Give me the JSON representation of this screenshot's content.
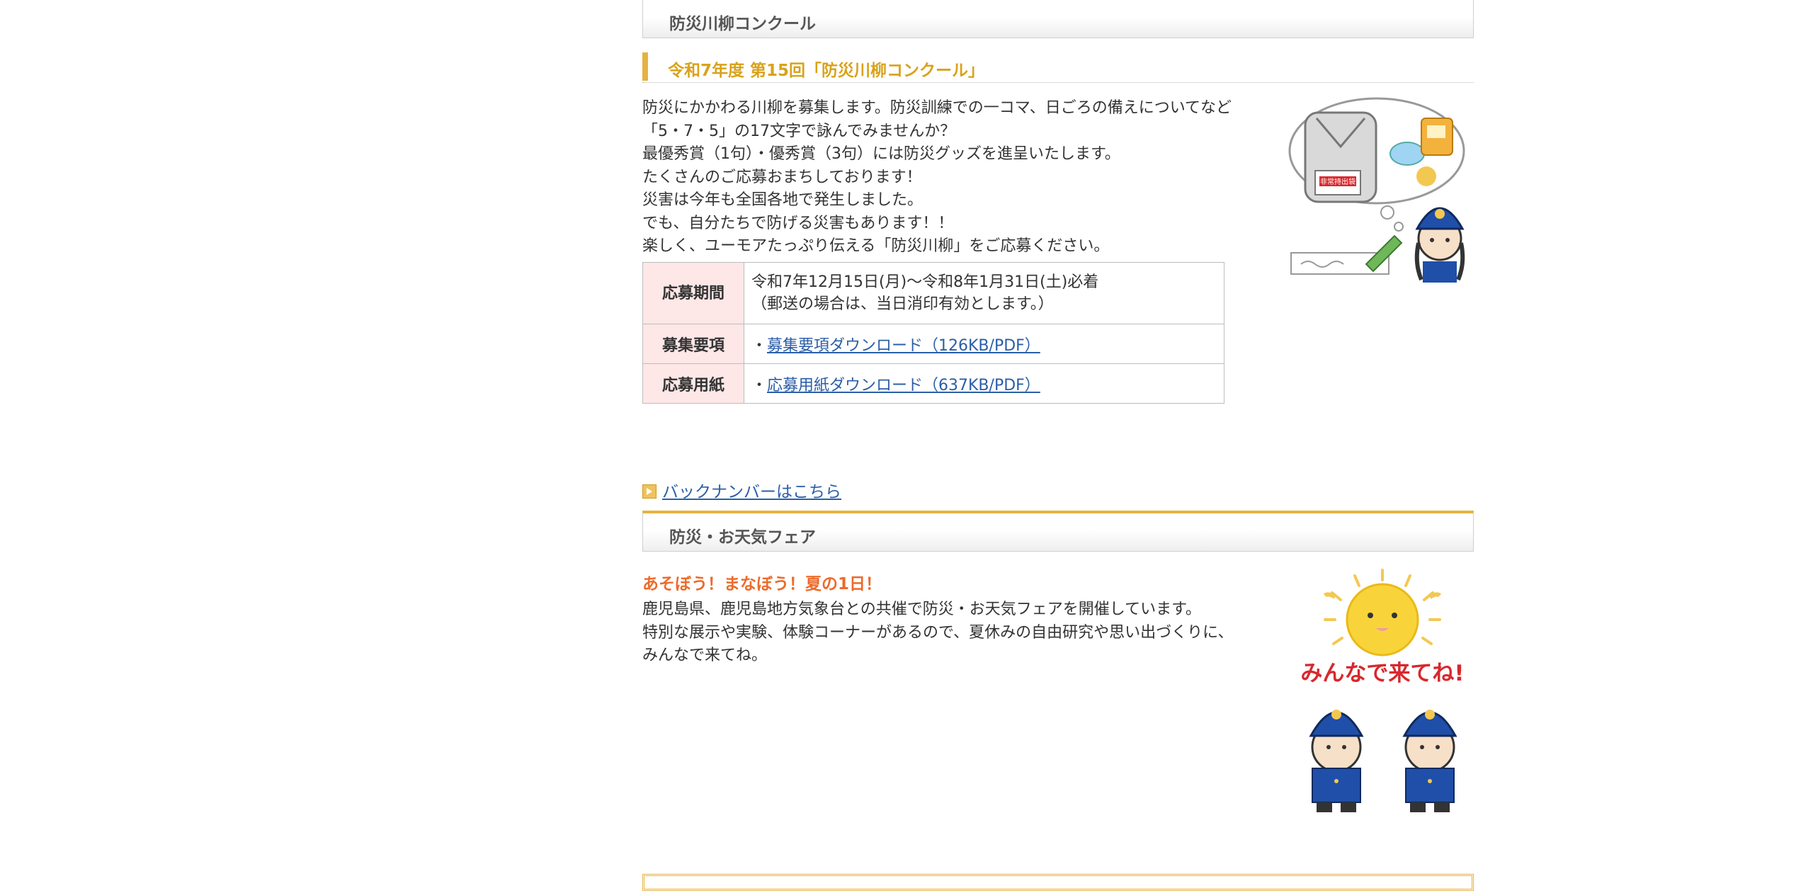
{
  "section1": {
    "header": "防災川柳コンクール",
    "subheader": "令和7年度 第15回「防災川柳コンクール」",
    "description": [
      "防災にかかわる川柳を募集します。防災訓練での一コマ、日ごろの備えについてなど",
      "「5・7・5」の17文字で詠んでみませんか？",
      "最優秀賞（1句）・優秀賞（3句）には防災グッズを進呈いたします。",
      "たくさんのご応募おまちしております！",
      "災害は今年も全国各地で発生しました。",
      "でも、自分たちで防げる災害もあります！！",
      "楽しく、ユーモアたっぷり伝える「防災川柳」をご応募ください。"
    ],
    "table": {
      "period_label": "応募期間",
      "period_line1": "令和7年12月15日(月)～令和8年1月31日(土)必着",
      "period_line2": "（郵送の場合は、当日消印有効とします。）",
      "guide_label": "募集要項",
      "guide_bullet": "・",
      "guide_link": "募集要項ダウンロード（126KB/PDF）",
      "form_label": "応募用紙",
      "form_bullet": "・",
      "form_link": "応募用紙ダウンロード（637KB/PDF）"
    },
    "illustration_bag_label": "非常持出袋",
    "backnumber_link": "バックナンバーはこちら"
  },
  "section2": {
    "header": "防災・お天気フェア",
    "catch": "あそぼう！まなぼう！夏の1日！",
    "description": [
      "鹿児島県、鹿児島地方気象台との共催で防災・お天気フェアを開催しています。",
      "特別な展示や実験、体験コーナーがあるので、夏休みの自由研究や思い出づくりに、",
      "みんなで来てね。"
    ],
    "illustration_text": "みんなで来てね!"
  },
  "colors": {
    "accent": "#e6b340",
    "subheading": "#d9a21a",
    "catch": "#ed6a2a",
    "link": "#2b5ea8",
    "table_header_bg": "#fde7e7"
  }
}
